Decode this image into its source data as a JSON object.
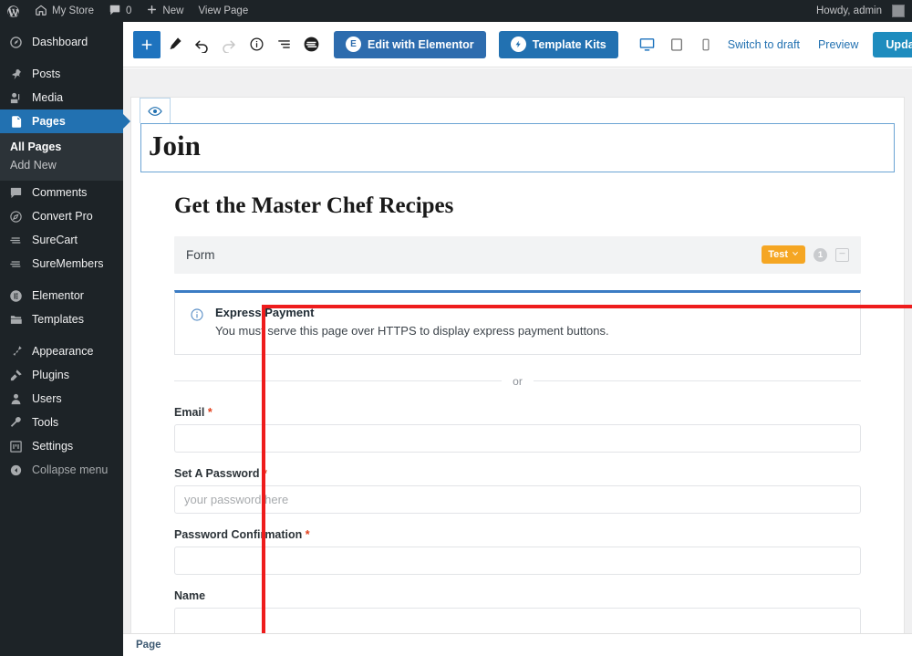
{
  "adminbar": {
    "logo_icon": "wordpress-logo-icon",
    "site_name": "My Store",
    "comments_count": "0",
    "new_label": "New",
    "view_page_label": "View Page",
    "howdy": "Howdy, admin"
  },
  "sidebar": {
    "items": [
      {
        "label": "Dashboard",
        "icon": "dashboard-icon",
        "current": false
      },
      {
        "label": "Posts",
        "icon": "pin-icon",
        "current": false
      },
      {
        "label": "Media",
        "icon": "media-icon",
        "current": false
      },
      {
        "label": "Pages",
        "icon": "pages-icon",
        "current": true
      },
      {
        "label": "Comments",
        "icon": "comments-icon",
        "current": false
      },
      {
        "label": "Convert Pro",
        "icon": "convert-pro-icon",
        "current": false
      },
      {
        "label": "SureCart",
        "icon": "surecart-icon",
        "current": false
      },
      {
        "label": "SureMembers",
        "icon": "suremembers-icon",
        "current": false
      },
      {
        "label": "Elementor",
        "icon": "elementor-icon",
        "current": false
      },
      {
        "label": "Templates",
        "icon": "templates-icon",
        "current": false
      },
      {
        "label": "Appearance",
        "icon": "appearance-icon",
        "current": false
      },
      {
        "label": "Plugins",
        "icon": "plugins-icon",
        "current": false
      },
      {
        "label": "Users",
        "icon": "users-icon",
        "current": false
      },
      {
        "label": "Tools",
        "icon": "tools-icon",
        "current": false
      },
      {
        "label": "Settings",
        "icon": "settings-icon",
        "current": false
      },
      {
        "label": "Collapse menu",
        "icon": "collapse-icon",
        "current": false
      }
    ],
    "submenu": [
      {
        "label": "All Pages",
        "active": true
      },
      {
        "label": "Add New",
        "active": false
      }
    ]
  },
  "toolbar": {
    "add_block_icon": "plus-icon",
    "tools_icon": "pencil-icon",
    "undo_icon": "undo-icon",
    "redo_icon": "redo-icon",
    "details_icon": "info-icon",
    "list_view_icon": "list-view-icon",
    "surecart_icon": "surecart-circle-icon",
    "elementor_label": "Edit with Elementor",
    "elementor_badge": "E",
    "template_kits_label": "Template Kits",
    "template_kits_badge": "⚡",
    "device_desktop_icon": "desktop-icon",
    "device_tablet_icon": "tablet-icon",
    "device_mobile_icon": "mobile-icon",
    "switch_to_draft_label": "Switch to draft",
    "preview_label": "Preview",
    "update_label": "Update",
    "settings_icon": "gear-icon",
    "astra_icon": "astra-logo-icon",
    "more_icon": "kebab-menu-icon"
  },
  "canvas": {
    "preview_tab_icon": "eye-icon",
    "post_title": "Join",
    "heading": "Get the Master Chef Recipes",
    "form_bar": {
      "label": "Form",
      "test_button_label": "Test",
      "test_chevron_icon": "chevron-down-icon",
      "step_badge": "1",
      "panel_icon": "panel-icon"
    },
    "express_payment": {
      "info_icon": "info-circle-icon",
      "title": "Express Payment",
      "description": "You must serve this page over HTTPS to display express payment buttons."
    },
    "divider_label": "or",
    "fields": [
      {
        "label": "Email",
        "required": true,
        "value": "",
        "placeholder": ""
      },
      {
        "label": "Set A Password",
        "required": true,
        "value": "",
        "placeholder": "your password here"
      },
      {
        "label": "Password Confirmation",
        "required": true,
        "value": "",
        "placeholder": ""
      },
      {
        "label": "Name",
        "required": false,
        "value": "",
        "placeholder": ""
      }
    ]
  },
  "bottom_bar": {
    "breadcrumb": "Page"
  },
  "colors": {
    "admin_dark": "#1d2327",
    "accent_blue": "#2271b1",
    "update_blue": "#1e8cbe",
    "annotation_red": "#ee1c1c",
    "test_orange": "#f5a623",
    "required_red": "#e2401c"
  }
}
